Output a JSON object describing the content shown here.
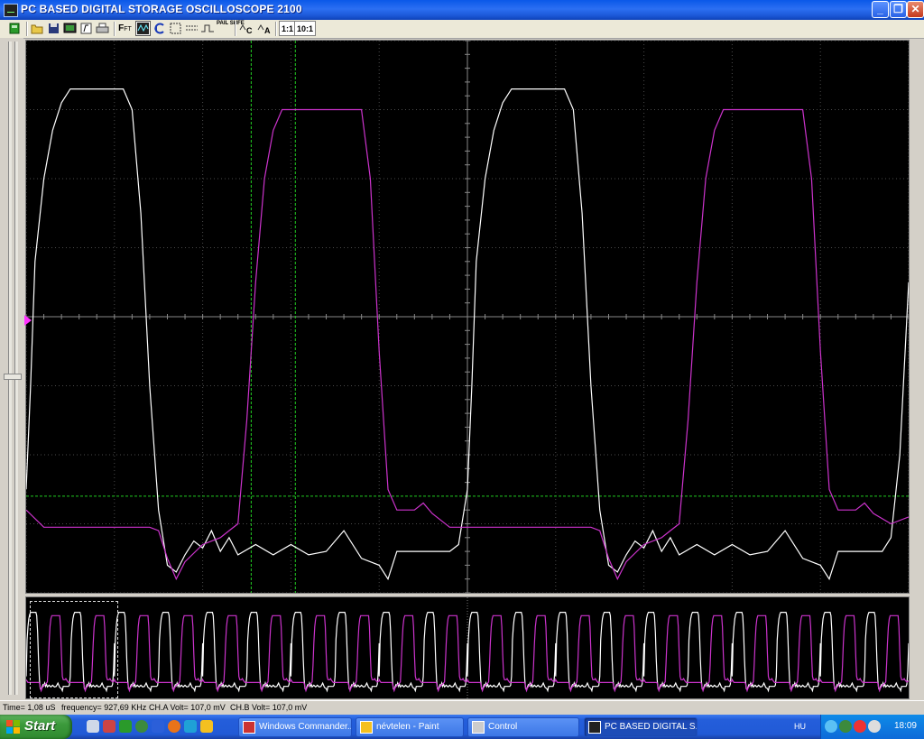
{
  "window": {
    "title": "PC BASED DIGITAL STORAGE OSCILLOSCOPE 2100",
    "controls": [
      "_",
      "❐",
      "✕"
    ]
  },
  "toolbar": {
    "ratio_a": "1:1",
    "ratio_b": "10:1",
    "fft_label": "F",
    "fft_sub": "FT",
    "pass_fail": "PAIL SHFE",
    "icons": [
      "chip-icon",
      "open-folder-icon",
      "save-disk-icon",
      "screen-icon",
      "function-icon",
      "print-icon",
      "fft-icon",
      "scope-view-icon",
      "return-arrow-icon",
      "rect-select-icon",
      "dashed-line-icon",
      "step-wave-icon",
      "pass-fail-icon",
      "cursor-c-icon",
      "cursor-a-icon"
    ]
  },
  "status": {
    "time": "Time= 1,08 uS",
    "frequency": "frequency= 927,69 KHz",
    "cha": "CH.A Volt= 107,0 mV",
    "chb": "CH.B Volt= 107,0 mV"
  },
  "colors": {
    "channel_a": "#ffffff",
    "channel_b": "#cc33cc",
    "grid": "#4a4a4a",
    "cursor": "#22cc22",
    "marker": "#ff33ff"
  },
  "chart_data": {
    "type": "line",
    "title": "",
    "xlabel": "",
    "ylabel": "",
    "grid": true,
    "x_divisions": 10,
    "y_divisions": 8,
    "xlim": [
      0,
      10
    ],
    "ylim": [
      0,
      8
    ],
    "series": [
      {
        "x": [
          0.0,
          0.05,
          0.1,
          0.2,
          0.3,
          0.4,
          0.5,
          0.7,
          0.9,
          1.1,
          1.2,
          1.3,
          1.4,
          1.5,
          1.6,
          1.7,
          1.8,
          1.9,
          2.0,
          2.1,
          2.2,
          2.3,
          2.4,
          2.6,
          2.8,
          3.0,
          3.2,
          3.4,
          3.6,
          3.8,
          4.0,
          4.1,
          4.2,
          4.3,
          4.4,
          4.5,
          4.6,
          4.7,
          4.8,
          4.9,
          5.0,
          5.05,
          5.1,
          5.2,
          5.3,
          5.4,
          5.5,
          5.7,
          5.9,
          6.1,
          6.2,
          6.3,
          6.4,
          6.5,
          6.6,
          6.7,
          6.8,
          6.9,
          7.0,
          7.1,
          7.2,
          7.3,
          7.4,
          7.6,
          7.8,
          8.0,
          8.2,
          8.4,
          8.6,
          8.8,
          9.0,
          9.1,
          9.2,
          9.3,
          9.4,
          9.5,
          9.6,
          9.7,
          9.8,
          9.9,
          10.0
        ],
        "values": [
          1.5,
          3.0,
          4.8,
          6.0,
          6.7,
          7.1,
          7.3,
          7.3,
          7.3,
          7.3,
          7.0,
          5.5,
          3.0,
          1.2,
          0.4,
          0.3,
          0.55,
          0.75,
          0.65,
          0.9,
          0.6,
          0.8,
          0.55,
          0.7,
          0.55,
          0.7,
          0.55,
          0.6,
          0.9,
          0.5,
          0.4,
          0.2,
          0.6,
          0.6,
          0.6,
          0.6,
          0.6,
          0.6,
          0.6,
          0.7,
          1.5,
          3.0,
          4.8,
          6.0,
          6.7,
          7.1,
          7.3,
          7.3,
          7.3,
          7.3,
          7.0,
          5.5,
          3.0,
          1.2,
          0.4,
          0.3,
          0.55,
          0.75,
          0.65,
          0.9,
          0.6,
          0.8,
          0.55,
          0.7,
          0.55,
          0.7,
          0.55,
          0.6,
          0.9,
          0.5,
          0.4,
          0.2,
          0.6,
          0.6,
          0.6,
          0.6,
          0.6,
          0.6,
          0.8,
          2.0,
          4.5
        ]
      },
      {
        "x": [
          0.0,
          0.2,
          0.4,
          0.6,
          0.8,
          1.0,
          1.2,
          1.4,
          1.5,
          1.6,
          1.7,
          1.8,
          2.0,
          2.2,
          2.3,
          2.4,
          2.5,
          2.6,
          2.7,
          2.8,
          2.9,
          3.0,
          3.2,
          3.4,
          3.6,
          3.8,
          3.9,
          4.0,
          4.1,
          4.2,
          4.3,
          4.4,
          4.5,
          4.6,
          4.8,
          5.0,
          5.2,
          5.4,
          5.6,
          5.8,
          6.0,
          6.2,
          6.4,
          6.5,
          6.6,
          6.7,
          6.8,
          7.0,
          7.2,
          7.3,
          7.4,
          7.5,
          7.6,
          7.7,
          7.8,
          7.9,
          8.0,
          8.2,
          8.4,
          8.6,
          8.8,
          8.9,
          9.0,
          9.1,
          9.2,
          9.3,
          9.4,
          9.5,
          9.6,
          9.8,
          10.0
        ],
        "values": [
          1.2,
          0.95,
          0.95,
          0.95,
          0.95,
          0.95,
          0.95,
          0.95,
          0.9,
          0.5,
          0.2,
          0.45,
          0.7,
          0.8,
          0.9,
          1.0,
          2.5,
          4.5,
          6.0,
          6.7,
          7.0,
          7.0,
          7.0,
          7.0,
          7.0,
          7.0,
          6.0,
          3.5,
          1.5,
          1.2,
          1.2,
          1.2,
          1.3,
          1.15,
          0.95,
          0.95,
          0.95,
          0.95,
          0.95,
          0.95,
          0.95,
          0.95,
          0.95,
          0.9,
          0.5,
          0.2,
          0.45,
          0.7,
          0.8,
          0.9,
          1.0,
          2.5,
          4.5,
          6.0,
          6.7,
          7.0,
          7.0,
          7.0,
          7.0,
          7.0,
          7.0,
          6.0,
          3.5,
          1.5,
          1.2,
          1.2,
          1.2,
          1.3,
          1.15,
          1.0,
          1.1
        ]
      }
    ]
  }
}
